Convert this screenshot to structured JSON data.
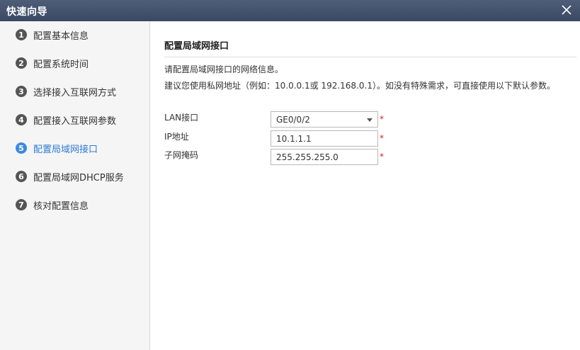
{
  "dialog": {
    "title": "快速向导",
    "close_icon": "close-icon"
  },
  "steps": [
    {
      "num": "1",
      "label": "配置基本信息",
      "active": false
    },
    {
      "num": "2",
      "label": "配置系统时间",
      "active": false
    },
    {
      "num": "3",
      "label": "选择接入互联网方式",
      "active": false
    },
    {
      "num": "4",
      "label": "配置接入互联网参数",
      "active": false
    },
    {
      "num": "5",
      "label": "配置局域网接口",
      "active": true
    },
    {
      "num": "6",
      "label": "配置局域网DHCP服务",
      "active": false
    },
    {
      "num": "7",
      "label": "核对配置信息",
      "active": false
    }
  ],
  "main": {
    "title": "配置局域网接口",
    "desc1": "请配置局域网接口的网络信息。",
    "desc2": "建议您使用私网地址（例如：10.0.0.1或 192.168.0.1）。如没有特殊需求，可直接使用以下默认参数。",
    "fields": {
      "lan": {
        "label": "LAN接口",
        "value": "GE0/0/2",
        "required": "*"
      },
      "ip": {
        "label": "IP地址",
        "value": "10.1.1.1",
        "required": "*"
      },
      "mask": {
        "label": "子网掩码",
        "value": "255.255.255.0",
        "required": "*"
      }
    }
  },
  "colors": {
    "titlebar": "#3f4d69",
    "active_step": "#3b8ae0",
    "required": "#e02020"
  }
}
